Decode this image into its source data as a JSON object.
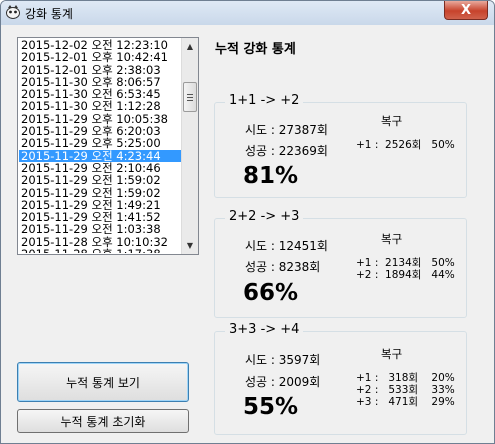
{
  "window": {
    "title": "강화 통계",
    "close_label": "X"
  },
  "history_list": {
    "items": [
      "2015-12-02 오전 12:23:10",
      "2015-12-01 오후 10:42:41",
      "2015-12-01 오후 2:38:03",
      "2015-11-30 오후 8:06:57",
      "2015-11-30 오전 6:53:45",
      "2015-11-30 오전 1:12:28",
      "2015-11-29 오후 10:05:38",
      "2015-11-29 오후 6:20:03",
      "2015-11-29 오후 5:25:00",
      "2015-11-29 오전 4:23:44",
      "2015-11-29 오전 2:10:46",
      "2015-11-29 오전 1:59:02",
      "2015-11-29 오전 1:59:02",
      "2015-11-29 오전 1:49:21",
      "2015-11-29 오전 1:41:52",
      "2015-11-29 오전 1:03:38",
      "2015-11-28 오후 10:10:32",
      "2015-11-28 오후 1:17:38"
    ],
    "selected_index": 9
  },
  "buttons": {
    "view_label": "누적 통계 보기",
    "reset_label": "누적 통계 초기화"
  },
  "panel": {
    "title": "누적 강화 통계",
    "restore_label": "복구",
    "groups": [
      {
        "title": "1+1  -> +2",
        "attempts": "시도 : 27387회",
        "successes": "성공 : 22369회",
        "rate": "81%",
        "restore_rows": [
          "+1 :  2526회   50%"
        ]
      },
      {
        "title": "2+2  -> +3",
        "attempts": "시도 : 12451회",
        "successes": "성공 : 8238회",
        "rate": "66%",
        "restore_rows": [
          "+1 :  2134회   50%",
          "+2 :  1894회   44%"
        ]
      },
      {
        "title": "3+3  -> +4",
        "attempts": "시도 : 3597회",
        "successes": "성공 : 2009회",
        "rate": "55%",
        "restore_rows": [
          "+1 :   318회    20%",
          "+2 :   533회    33%",
          "+3 :   471회    29%"
        ]
      }
    ]
  },
  "colors": {
    "selection": "#3399ff",
    "window_bg": "#f0f0f0",
    "close_button": "#c7432c"
  }
}
